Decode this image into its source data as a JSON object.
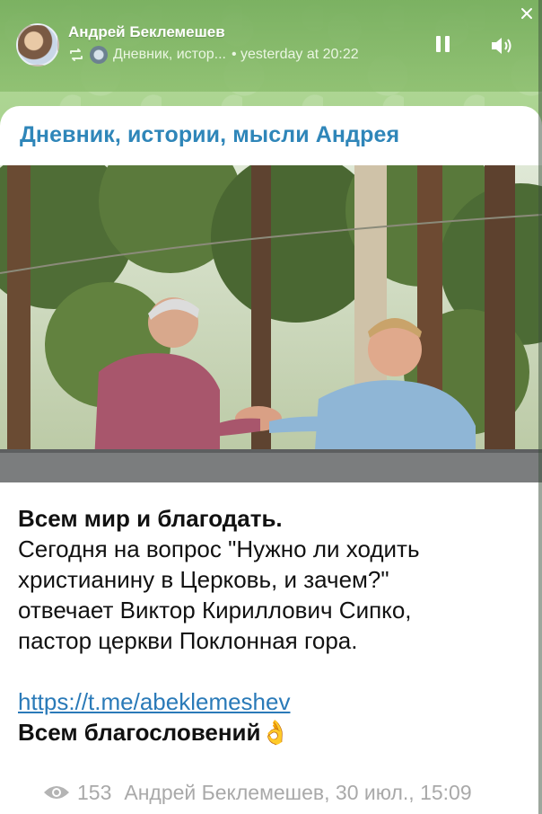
{
  "player": {
    "author": "Андрей Беклемешев",
    "source": "Дневник, истор...",
    "time": "• yesterday at 20:22"
  },
  "post": {
    "channel_title": "Дневник, истории, мысли Андрея",
    "text_lines": [
      "Всем мир и благодать.",
      "Сегодня на вопрос \"Нужно ли ходить",
      "христианину в Церковь, и зачем?\"",
      "отвечает Виктор Кириллович Сипко,",
      "пастор церкви Поклонная гора."
    ],
    "link": "https://t.me/abeklemeshev",
    "blessing": "Всем благословений",
    "blessing_emoji": "👌",
    "views": "153",
    "signature": "Андрей Беклемешев, 30 июл., 15:09"
  },
  "colors": {
    "accent": "#2f86b9",
    "link": "#2a7ab8",
    "footer": "#a9a9a9"
  },
  "icons": [
    "repeat-icon",
    "pause-icon",
    "volume-icon",
    "close-icon",
    "eye-icon"
  ]
}
